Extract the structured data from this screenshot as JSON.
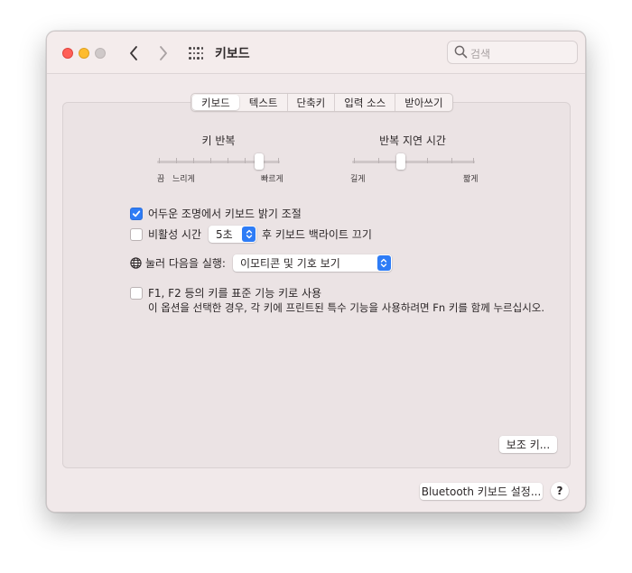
{
  "window": {
    "title": "키보드"
  },
  "search": {
    "placeholder": "검색"
  },
  "tabs": [
    {
      "label": "키보드",
      "active": true
    },
    {
      "label": "텍스트",
      "active": false
    },
    {
      "label": "단축키",
      "active": false
    },
    {
      "label": "입력 소스",
      "active": false
    },
    {
      "label": "받아쓰기",
      "active": false
    }
  ],
  "key_repeat": {
    "label": "키 반복",
    "left": "끔",
    "left2": "느리게",
    "right": "빠르게",
    "level": 0.83
  },
  "repeat_delay": {
    "label": "반복 지연 시간",
    "left": "길게",
    "right": "짧게",
    "level": 0.4
  },
  "options": {
    "backlight": {
      "label": "어두운 조명에서 키보드 밝기 조절",
      "checked": true
    },
    "inactivity_prefix": "비활성 시간",
    "inactivity_value": "5초",
    "inactivity_suffix": "후 키보드 백라이트 끄기",
    "inactivity_checked": false,
    "globe_label": "눌러 다음을 실행:",
    "globe_value": "이모티콘 및 기호 보기",
    "fn_label": "F1, F2 등의 키를 표준 기능 키로 사용",
    "fn_desc": "이 옵션을 선택한 경우, 각 키에 프린트된 특수 기능을 사용하려면 Fn 키를 함께 누르십시오.",
    "fn_checked": false
  },
  "buttons": {
    "modifier": "보조 키...",
    "bluetooth": "Bluetooth 키보드 설정...",
    "help": "?"
  },
  "colors": {
    "accent": "#2e7cf6",
    "highlight": "#fbf07a"
  }
}
